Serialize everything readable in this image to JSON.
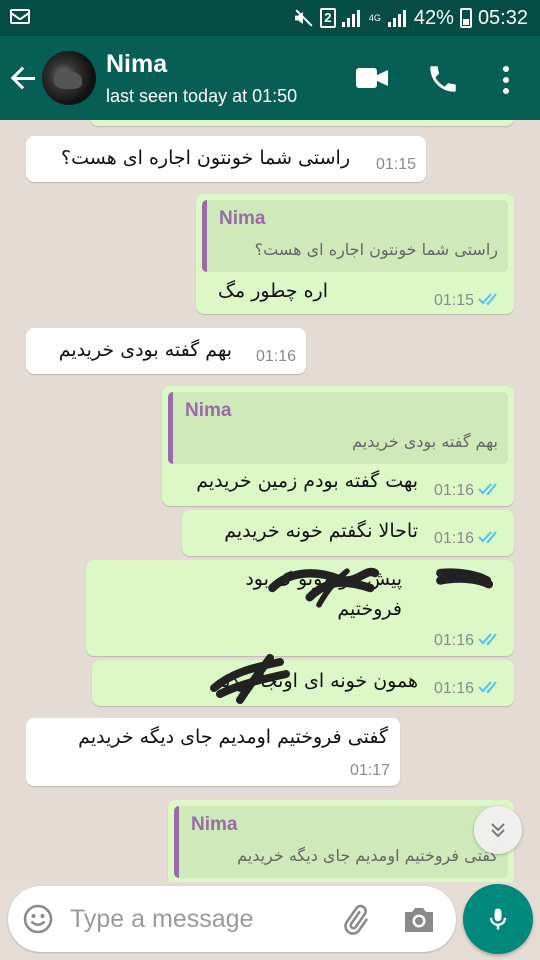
{
  "status_bar": {
    "sim_label": "2",
    "network_type": "4G",
    "battery": "42%",
    "clock": "05:32"
  },
  "header": {
    "contact_name": "Nima",
    "last_seen": "last seen today at 01:50"
  },
  "messages": [
    {
      "side": "in",
      "text": "راستی شما خونتون اجاره ای  هست؟",
      "time": "01:15"
    },
    {
      "side": "out",
      "quote_name": "Nima",
      "quote_text": "راستی شما خونتون اجاره ای  هست؟",
      "text": "اره چطور مگ",
      "time": "01:15"
    },
    {
      "side": "in",
      "text": "بهم گفته بودی خریدیم",
      "time": "01:16"
    },
    {
      "side": "out",
      "quote_name": "Nima",
      "quote_text": "بهم گفته بودی خریدیم",
      "text": "بهت گفته بودم زمین خریدیم",
      "time": "01:16"
    },
    {
      "side": "out",
      "text": "تاحالا نگفتم خونه خریدیم",
      "time": "01:16"
    },
    {
      "side": "out",
      "text": "پیش خونمونو ک  بود",
      "text2": "فروختیم",
      "time": "01:16"
    },
    {
      "side": "out",
      "text": "همون خونه ای   اونجا بودیم",
      "time": "01:16"
    },
    {
      "side": "in",
      "text": "گفتی فروختیم اومدیم جای دیگه خریدیم",
      "time": "01:17"
    },
    {
      "side": "out",
      "quote_name": "Nima",
      "quote_text": "گفتی فروختیم اومدیم جای دیگه خریدیم"
    }
  ],
  "composer": {
    "placeholder": "Type a message"
  },
  "colors": {
    "header": "#075e54",
    "status_bar": "#054d44",
    "outgoing_bubble": "#dcf8c6",
    "incoming_bubble": "#ffffff",
    "read_ticks": "#4fc3f7",
    "quote_accent": "#9a6ba9",
    "mic_button": "#00897b"
  },
  "icons": [
    "mail-icon",
    "mute-icon",
    "signal-icon",
    "battery-icon",
    "back-arrow-icon",
    "video-call-icon",
    "voice-call-icon",
    "more-options-icon",
    "read-receipt-icon",
    "scroll-down-icon",
    "emoji-icon",
    "attach-icon",
    "camera-icon",
    "mic-icon"
  ]
}
